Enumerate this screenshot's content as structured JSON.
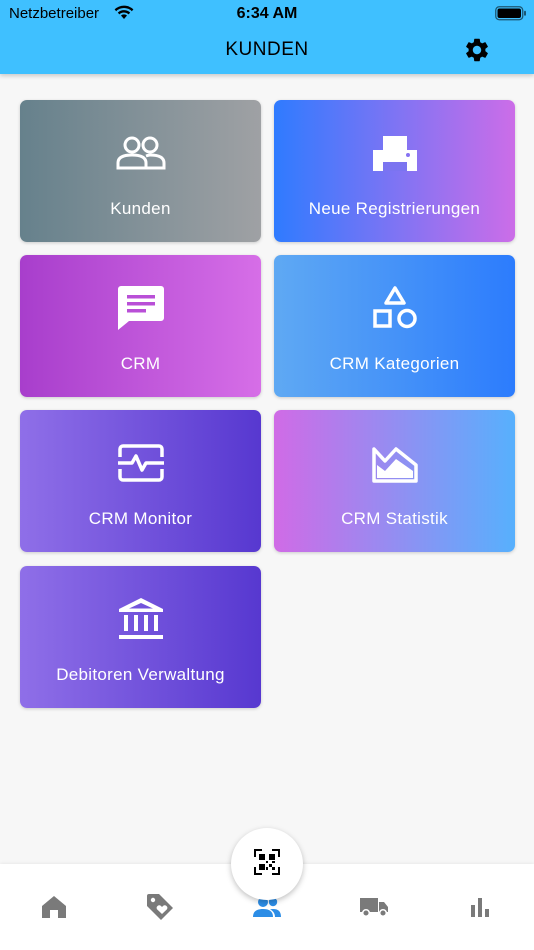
{
  "status_bar": {
    "carrier": "Netzbetreiber",
    "time": "6:34 AM",
    "wifi_icon": "wifi-icon",
    "battery_icon": "battery-icon"
  },
  "header": {
    "title": "KUNDEN",
    "settings_icon": "gear-icon",
    "background_color": "#3fc0ff"
  },
  "tiles": [
    {
      "label": "Kunden",
      "icon": "people-icon"
    },
    {
      "label": "Neue Registrierungen",
      "icon": "printer-icon"
    },
    {
      "label": "CRM",
      "icon": "message-icon"
    },
    {
      "label": "CRM Kategorien",
      "icon": "shapes-icon"
    },
    {
      "label": "CRM Monitor",
      "icon": "monitor-heartbeat-icon"
    },
    {
      "label": "CRM Statistik",
      "icon": "area-chart-icon"
    },
    {
      "label": "Debitoren Verwaltung",
      "icon": "bank-icon"
    }
  ],
  "bottom_nav": {
    "items": [
      {
        "icon": "home-icon",
        "active": false
      },
      {
        "icon": "tag-heart-icon",
        "active": false
      },
      {
        "icon": "people-icon",
        "active": true
      },
      {
        "icon": "truck-icon",
        "active": false
      },
      {
        "icon": "bar-chart-icon",
        "active": false
      }
    ],
    "fab_icon": "qr-code-icon",
    "active_color": "#2c8de6",
    "inactive_color": "#7a7a7a"
  }
}
